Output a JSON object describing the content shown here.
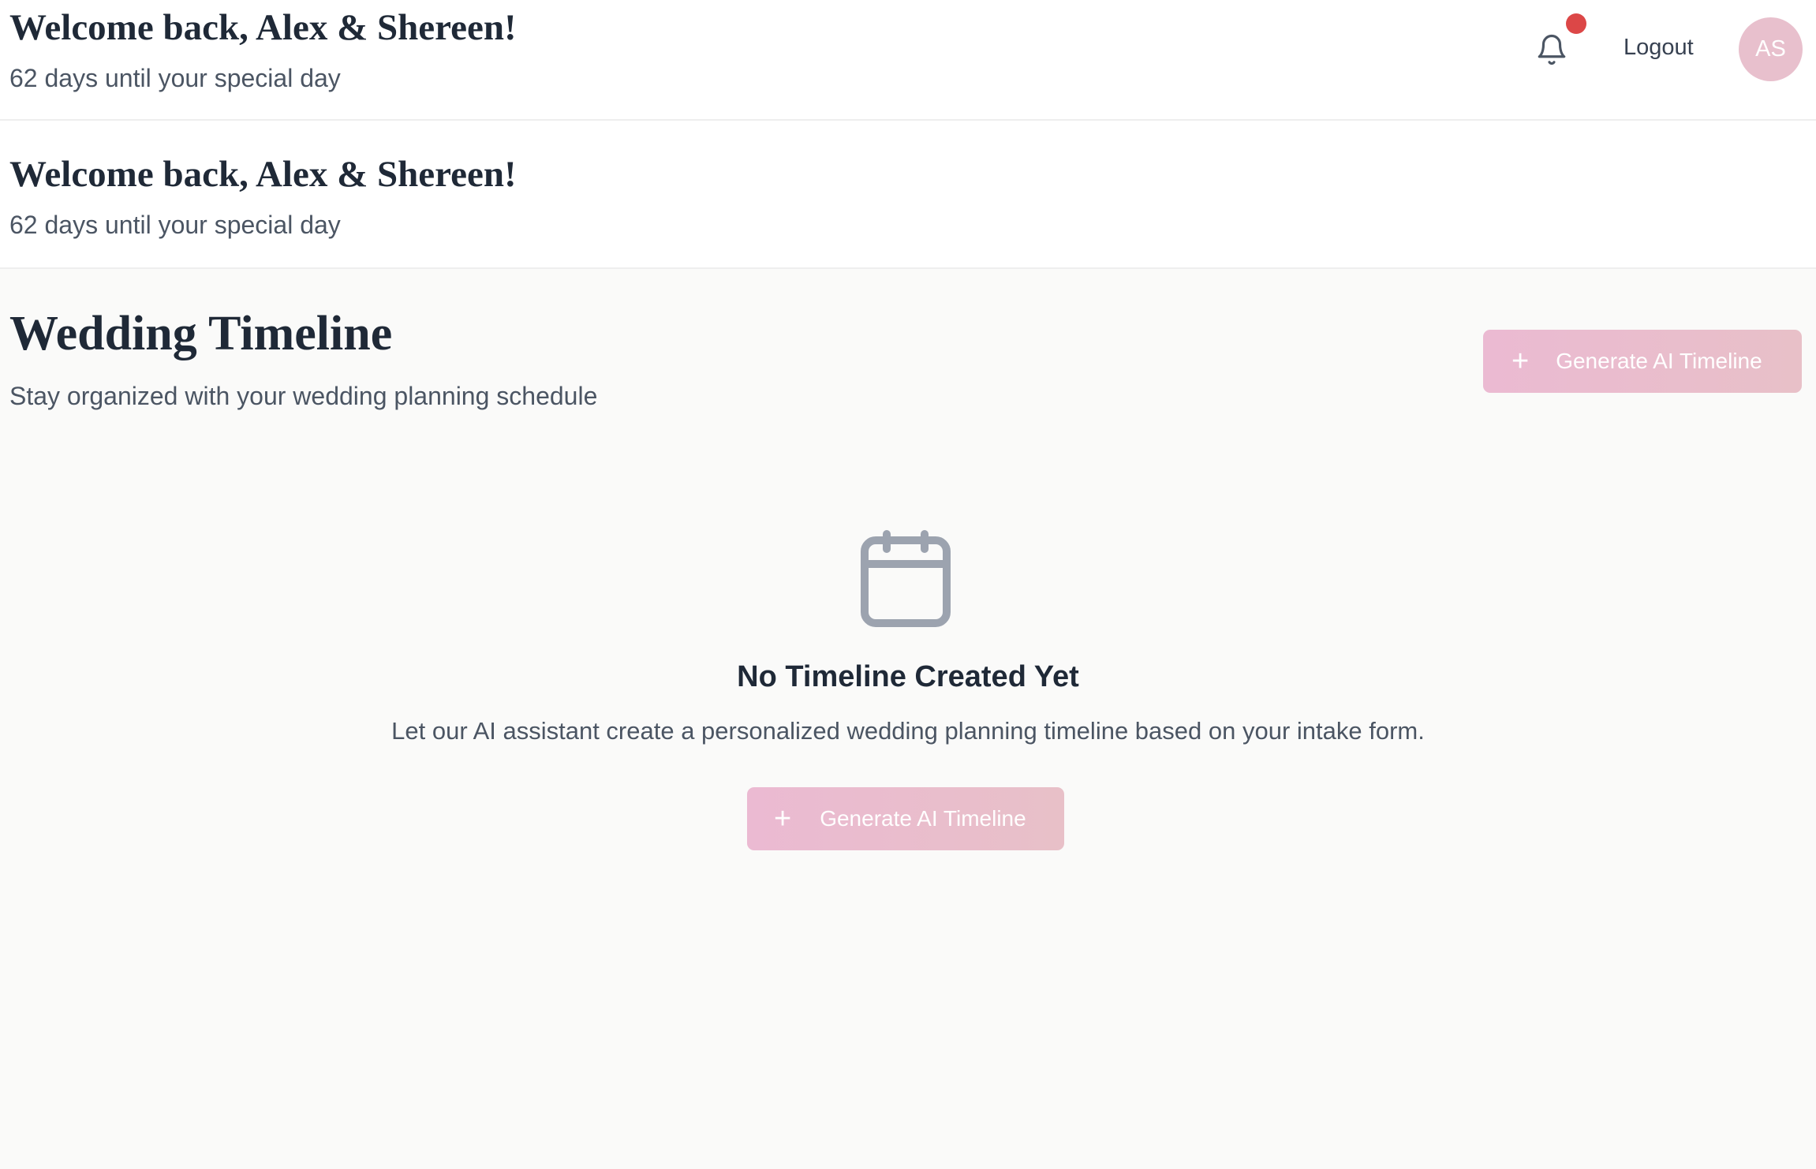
{
  "header": {
    "welcome_title": "Welcome back, Alex & Shereen!",
    "countdown": "62 days until your special day",
    "notification_icon": "bell-icon",
    "has_notification": true,
    "logout_label": "Logout",
    "avatar_initials": "AS"
  },
  "welcome": {
    "title": "Welcome back, Alex & Shereen!",
    "countdown": "62 days until your special day"
  },
  "page": {
    "title": "Wedding Timeline",
    "subtitle": "Stay organized with your wedding planning schedule",
    "generate_button": {
      "icon": "plus-icon",
      "label": "Generate AI Timeline"
    }
  },
  "empty_state": {
    "icon": "calendar-icon",
    "title": "No Timeline Created Yet",
    "description": "Let our AI assistant create a personalized wedding planning timeline based on your intake form.",
    "button": {
      "icon": "plus-icon",
      "label": "Generate AI Timeline"
    }
  },
  "colors": {
    "accent_pink": "#EBBAD2",
    "accent_rose": "#E8C0C8",
    "notification": "#DC4747",
    "background": "#FAFAF9",
    "text_primary": "#1F2937",
    "text_secondary": "#4B5563"
  }
}
